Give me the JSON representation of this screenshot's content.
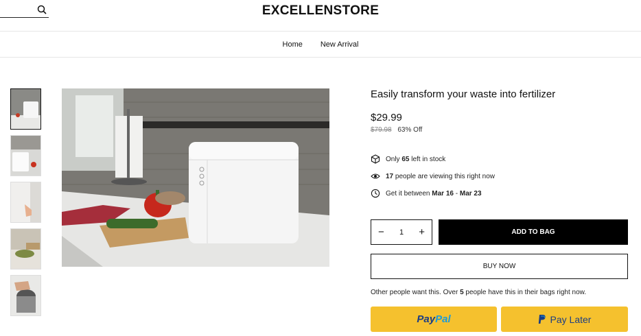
{
  "brand": "EXCELLENSTORE",
  "search": {
    "placeholder": ""
  },
  "nav": [
    "Home",
    "New Arrival"
  ],
  "product": {
    "title": "Easily transform your waste into fertilizer",
    "price": "$29.99",
    "old_price": "$79.98",
    "discount": "63% Off"
  },
  "stock": {
    "pre": "Only",
    "count": "65",
    "post": "left in stock"
  },
  "viewers": {
    "count": "17",
    "post": "people are viewing this right now"
  },
  "delivery": {
    "pre": "Get it between",
    "start": "Mar 16",
    "sep": "-",
    "end": "Mar 23"
  },
  "quantity": {
    "minus": "−",
    "value": "1",
    "plus": "+"
  },
  "buttons": {
    "add_to_bag": "ADD TO BAG",
    "buy_now": "BUY NOW"
  },
  "social": {
    "pre": "Other people want this. Over",
    "count": "5",
    "post": "people have this in their bags right now."
  },
  "paypal": {
    "part1": "Pay",
    "part2": "Pal",
    "pay_later": "Pay Later"
  },
  "colors": {
    "accent_black": "#000000",
    "paypal_yellow": "#f5c12e",
    "paypal_blue": "#1b3d84"
  },
  "icons": [
    "search-icon",
    "box-icon",
    "eye-icon",
    "clock-icon",
    "paypal-icon"
  ]
}
